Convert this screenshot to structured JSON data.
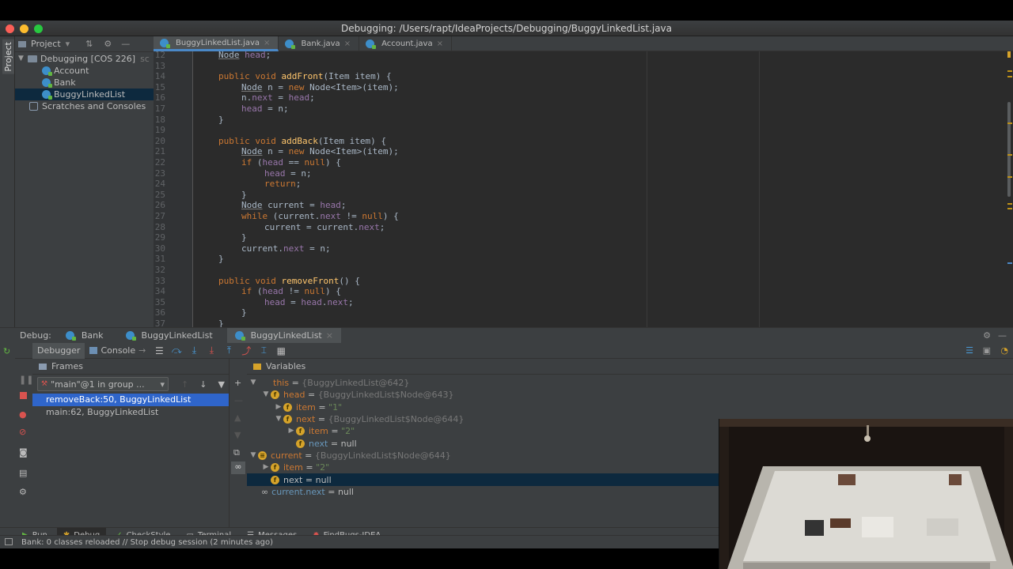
{
  "window": {
    "title": "Debugging:  /Users/rapt/IdeaProjects/Debugging/BuggyLinkedList.java"
  },
  "stripe": {
    "project_label": "Project"
  },
  "project_panel": {
    "title": "Project",
    "root": "Debugging [COS 226]",
    "root_suffix": "sc",
    "items": [
      "Account",
      "Bank",
      "BuggyLinkedList"
    ],
    "scratches": "Scratches and Consoles"
  },
  "tabs": [
    {
      "label": "BuggyLinkedList.java"
    },
    {
      "label": "Bank.java"
    },
    {
      "label": "Account.java"
    }
  ],
  "code": {
    "lines": [
      "12",
      "13",
      "14",
      "15",
      "16",
      "17",
      "18",
      "19",
      "20",
      "21",
      "22",
      "23",
      "24",
      "25",
      "26",
      "27",
      "28",
      "29",
      "30",
      "31",
      "32",
      "33",
      "34",
      "35",
      "36",
      "37"
    ]
  },
  "debug": {
    "label": "Debug:",
    "sessions": [
      "Bank",
      "BuggyLinkedList",
      "BuggyLinkedList"
    ],
    "debugger_tab": "Debugger",
    "console_tab": "Console",
    "frames_title": "Frames",
    "variables_title": "Variables",
    "thread": "\"main\"@1 in group ...",
    "frames": [
      "removeBack:50, BuggyLinkedList",
      "main:62, BuggyLinkedList"
    ]
  },
  "variables": [
    {
      "name": "this",
      "value": "{BuggyLinkedList@642}"
    },
    {
      "name": "head",
      "value": "{BuggyLinkedList$Node@643}"
    },
    {
      "name": "item",
      "value": "\"1\""
    },
    {
      "name": "next",
      "value": "{BuggyLinkedList$Node@644}"
    },
    {
      "name": "item",
      "value": "\"2\""
    },
    {
      "name": "next",
      "value": "null"
    },
    {
      "name": "current",
      "value": "{BuggyLinkedList$Node@644}"
    },
    {
      "name": "item",
      "value": "\"2\""
    },
    {
      "name": "next",
      "value": "null"
    },
    {
      "name": "current.next",
      "value": "null"
    }
  ],
  "bottom_tabs": [
    "Run",
    "Debug",
    "CheckStyle",
    "Terminal",
    "Messages",
    "FindBugs-IDEA"
  ],
  "status": "Bank: 0 classes reloaded // Stop debug session (2 minutes ago)",
  "colors": {
    "accent": "#2f65ca",
    "keyword": "#cc7832",
    "field": "#9876aa",
    "method": "#ffc66d"
  }
}
